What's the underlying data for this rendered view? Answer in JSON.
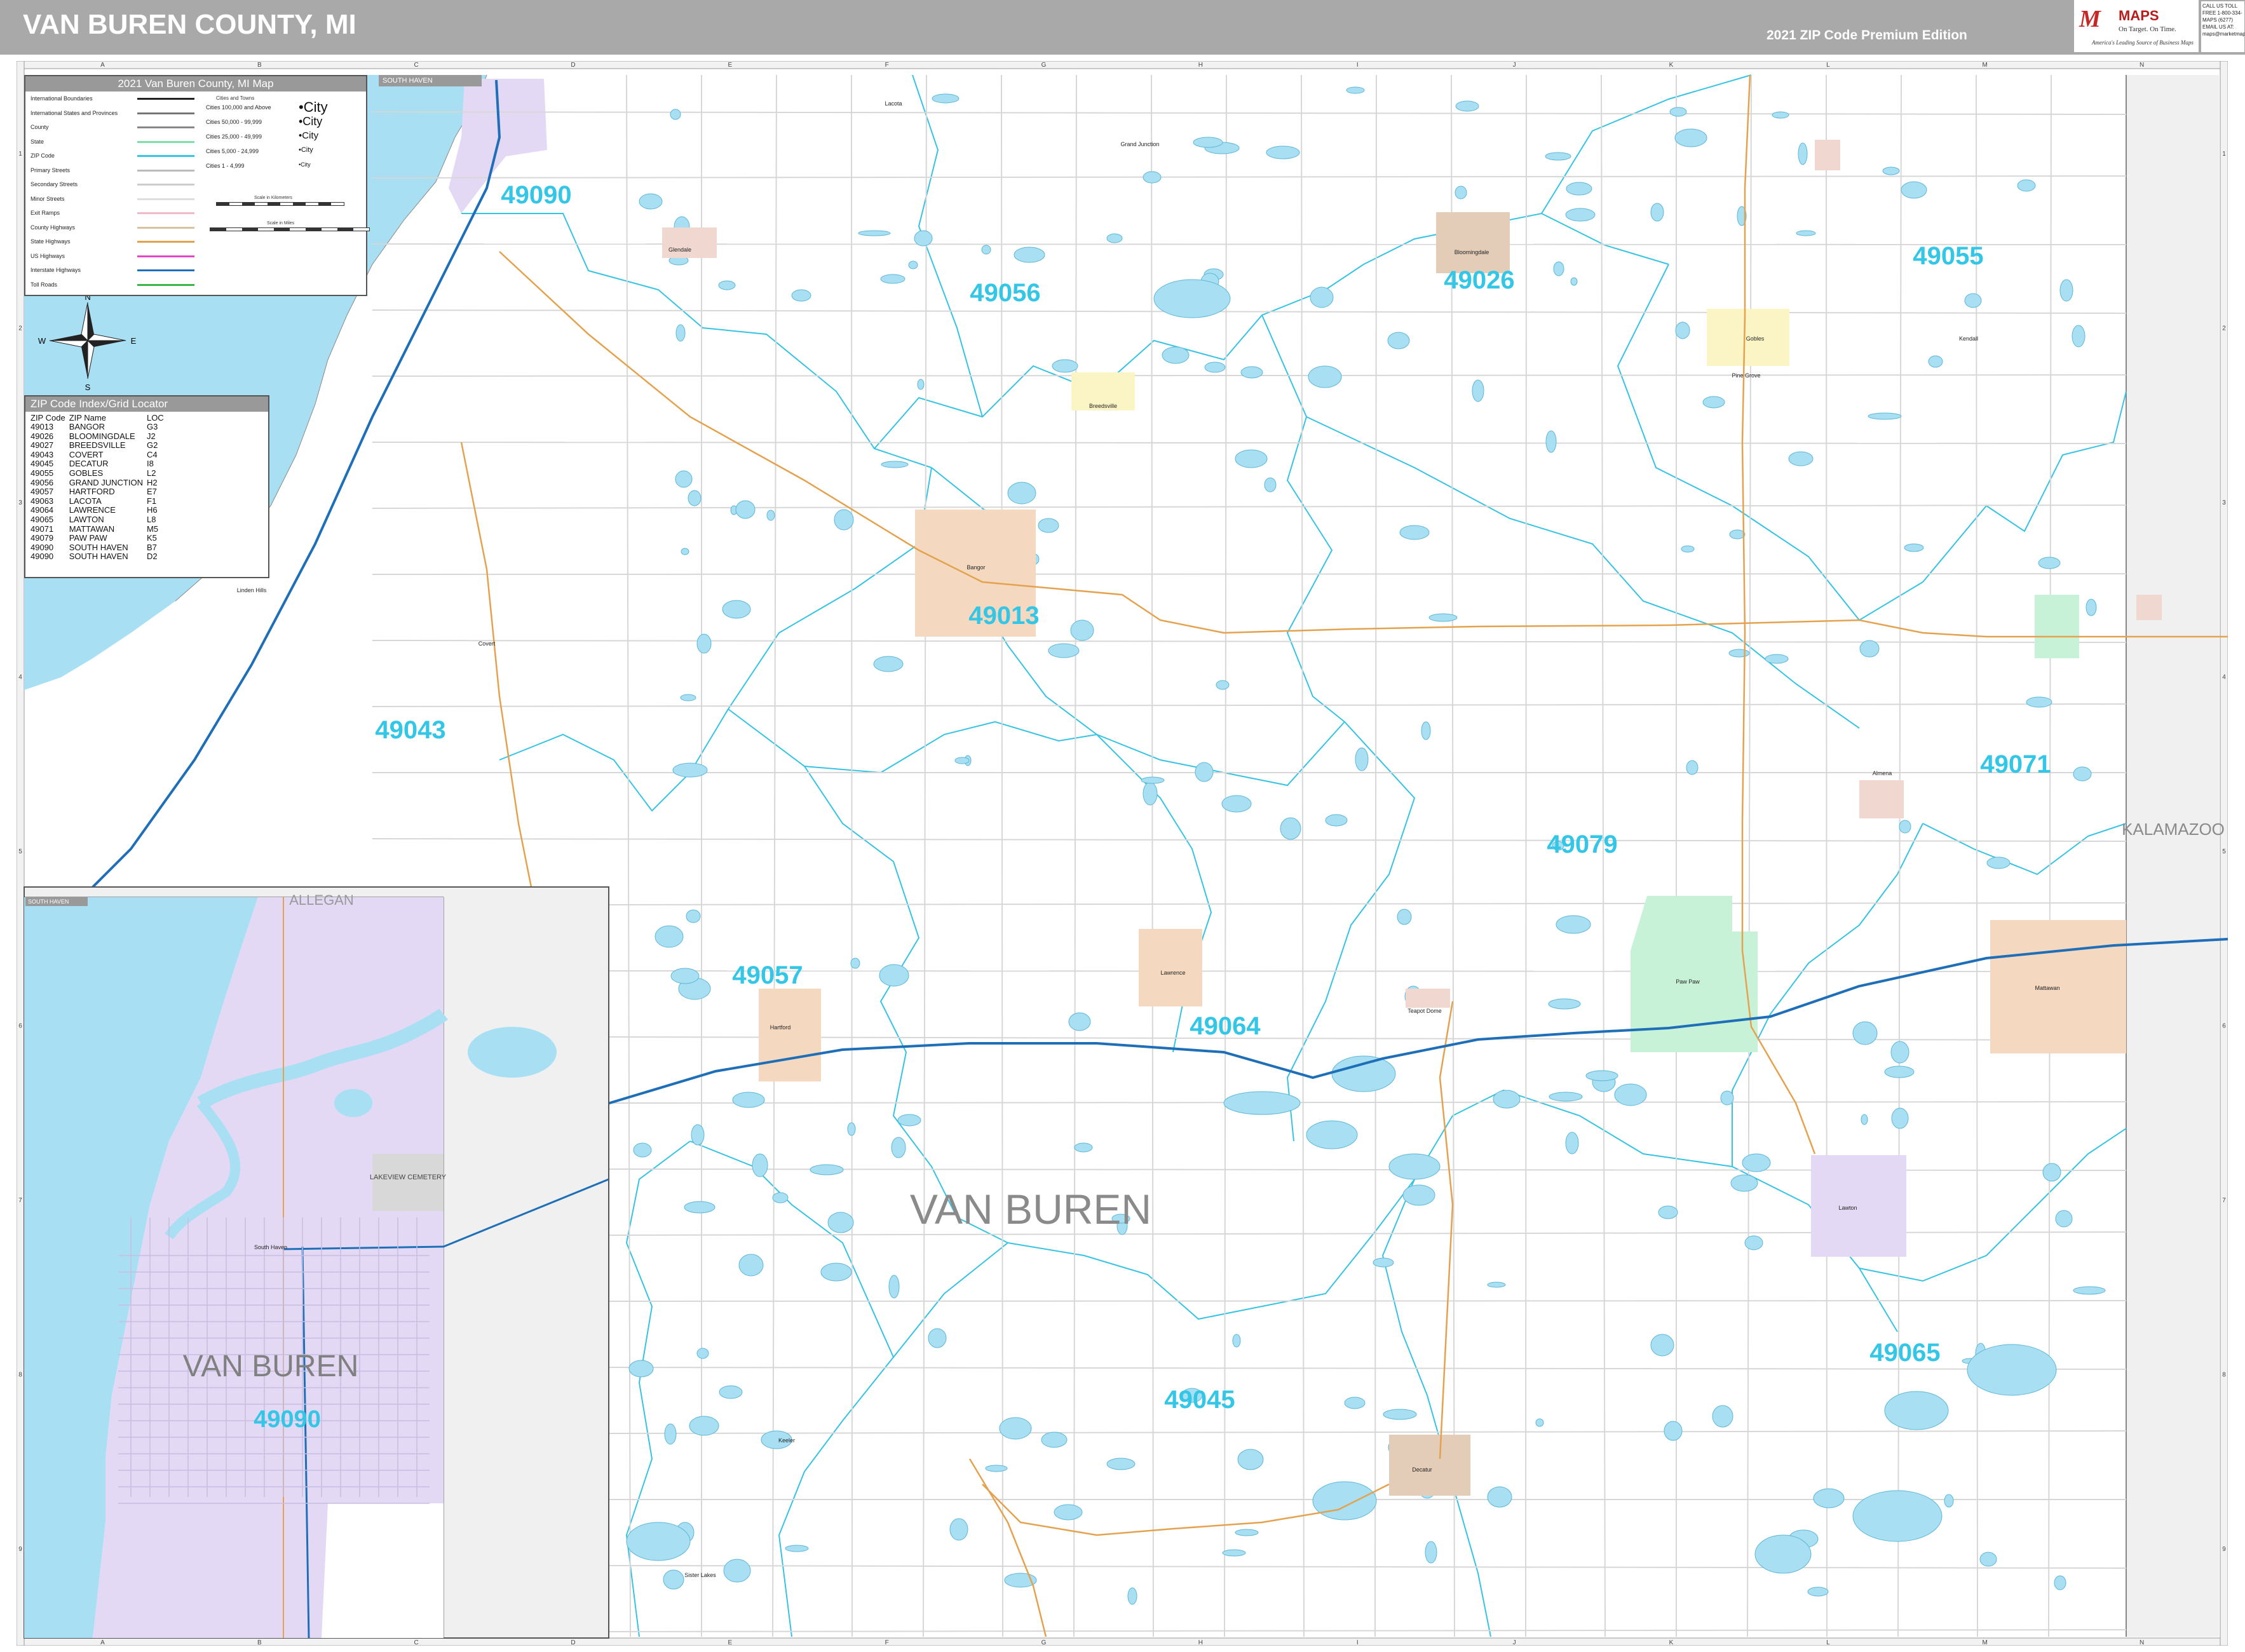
{
  "header": {
    "title": "VAN BUREN COUNTY, MI",
    "edition": "2021 ZIP Code Premium Edition",
    "brand_logo": "M",
    "brand_name": "MAPS",
    "brand_tagline": "On Target. On Time.",
    "brand_slogan": "America's Leading Source of Business Maps",
    "contact": "CALL US TOLL FREE 1-800-334-MAPS (6277) EMAIL US AT: maps@marketmaps.com"
  },
  "legend": {
    "title": "2021 Van Buren County, MI Map",
    "line_items": [
      {
        "label": "International Boundaries",
        "color": "#222222"
      },
      {
        "label": "International States and Provinces",
        "color": "#777777"
      },
      {
        "label": "County",
        "color": "#888888"
      },
      {
        "label": "State",
        "color": "#7ee0a8"
      },
      {
        "label": "ZIP Code",
        "color": "#33c6e6"
      },
      {
        "label": "Primary Streets",
        "color": "#bbbbbb"
      },
      {
        "label": "Secondary Streets",
        "color": "#cccccc"
      },
      {
        "label": "Minor Streets",
        "color": "#dddddd"
      },
      {
        "label": "Exit Ramps",
        "color": "#f3b9c9"
      },
      {
        "label": "County Highways",
        "color": "#d8c3a0"
      },
      {
        "label": "State Highways",
        "color": "#e4a24e"
      },
      {
        "label": "US Highways",
        "color": "#e545c7"
      },
      {
        "label": "Interstate Highways",
        "color": "#1e6fb8"
      },
      {
        "label": "Toll Roads",
        "color": "#3bb54a"
      }
    ],
    "city_sizes": [
      {
        "label": "Cities 100,000 and Above",
        "symbol": "•City"
      },
      {
        "label": "Cities 50,000 - 99,999",
        "symbol": "•City"
      },
      {
        "label": "Cities 25,000 - 49,999",
        "symbol": "•City"
      },
      {
        "label": "Cities 5,000 - 24,999",
        "symbol": "•City"
      },
      {
        "label": "Cities 1 - 4,999",
        "symbol": "•City"
      }
    ],
    "city_header": "Cities and Towns",
    "scale_km": "Scale in Kilometers",
    "scale_mi": "Scale in Miles"
  },
  "zip_index": {
    "title": "ZIP Code Index/Grid Locator",
    "headers": [
      "ZIP Code",
      "ZIP Name",
      "LOC"
    ],
    "rows": [
      [
        "49013",
        "BANGOR",
        "G3"
      ],
      [
        "49026",
        "BLOOMINGDALE",
        "J2"
      ],
      [
        "49027",
        "BREEDSVILLE",
        "G2"
      ],
      [
        "49043",
        "COVERT",
        "C4"
      ],
      [
        "49045",
        "DECATUR",
        "I8"
      ],
      [
        "49055",
        "GOBLES",
        "L2"
      ],
      [
        "49056",
        "GRAND JUNCTION",
        "H2"
      ],
      [
        "49057",
        "HARTFORD",
        "E7"
      ],
      [
        "49063",
        "LACOTA",
        "F1"
      ],
      [
        "49064",
        "LAWRENCE",
        "H6"
      ],
      [
        "49065",
        "LAWTON",
        "L8"
      ],
      [
        "49071",
        "MATTAWAN",
        "M5"
      ],
      [
        "49079",
        "PAW PAW",
        "K5"
      ],
      [
        "49090",
        "SOUTH HAVEN",
        "B7"
      ],
      [
        "49090",
        "SOUTH HAVEN",
        "D2"
      ]
    ]
  },
  "grid": {
    "columns": [
      "A",
      "B",
      "C",
      "D",
      "E",
      "F",
      "G",
      "H",
      "I",
      "J",
      "K",
      "L",
      "M",
      "N"
    ],
    "rows": [
      "1",
      "2",
      "3",
      "4",
      "5",
      "6",
      "7",
      "8",
      "9"
    ]
  },
  "map": {
    "county_label": "VAN BUREN",
    "neighbor_label": "KALAMAZOO",
    "zip_labels": [
      "49090",
      "49056",
      "49026",
      "49055",
      "49013",
      "49043",
      "49071",
      "49079",
      "49057",
      "49064",
      "49045",
      "49065"
    ],
    "town_labels": [
      "Lacota",
      "Grand Junction",
      "Bloomingdale",
      "Gobles",
      "Kendall",
      "Pine Grove",
      "Breedsville",
      "Bangor",
      "Lawrence",
      "Paw Paw",
      "Mattawan",
      "Lawton",
      "Decatur",
      "Hartford",
      "Covert",
      "Sister Lakes",
      "Glendale",
      "Keeler",
      "Almena",
      "Teapot Dome",
      "Linden Hills"
    ],
    "compass": {
      "n": "N",
      "s": "S",
      "e": "E",
      "w": "W"
    }
  },
  "inset": {
    "tab_top": "SOUTH HAVEN",
    "tab_inset": "SOUTH HAVEN",
    "allegan_label": "ALLEGAN",
    "county_label": "VAN BUREN",
    "zip_label": "49090",
    "town_label": "South Haven",
    "cemetery": "LAKEVIEW CEMETERY"
  }
}
